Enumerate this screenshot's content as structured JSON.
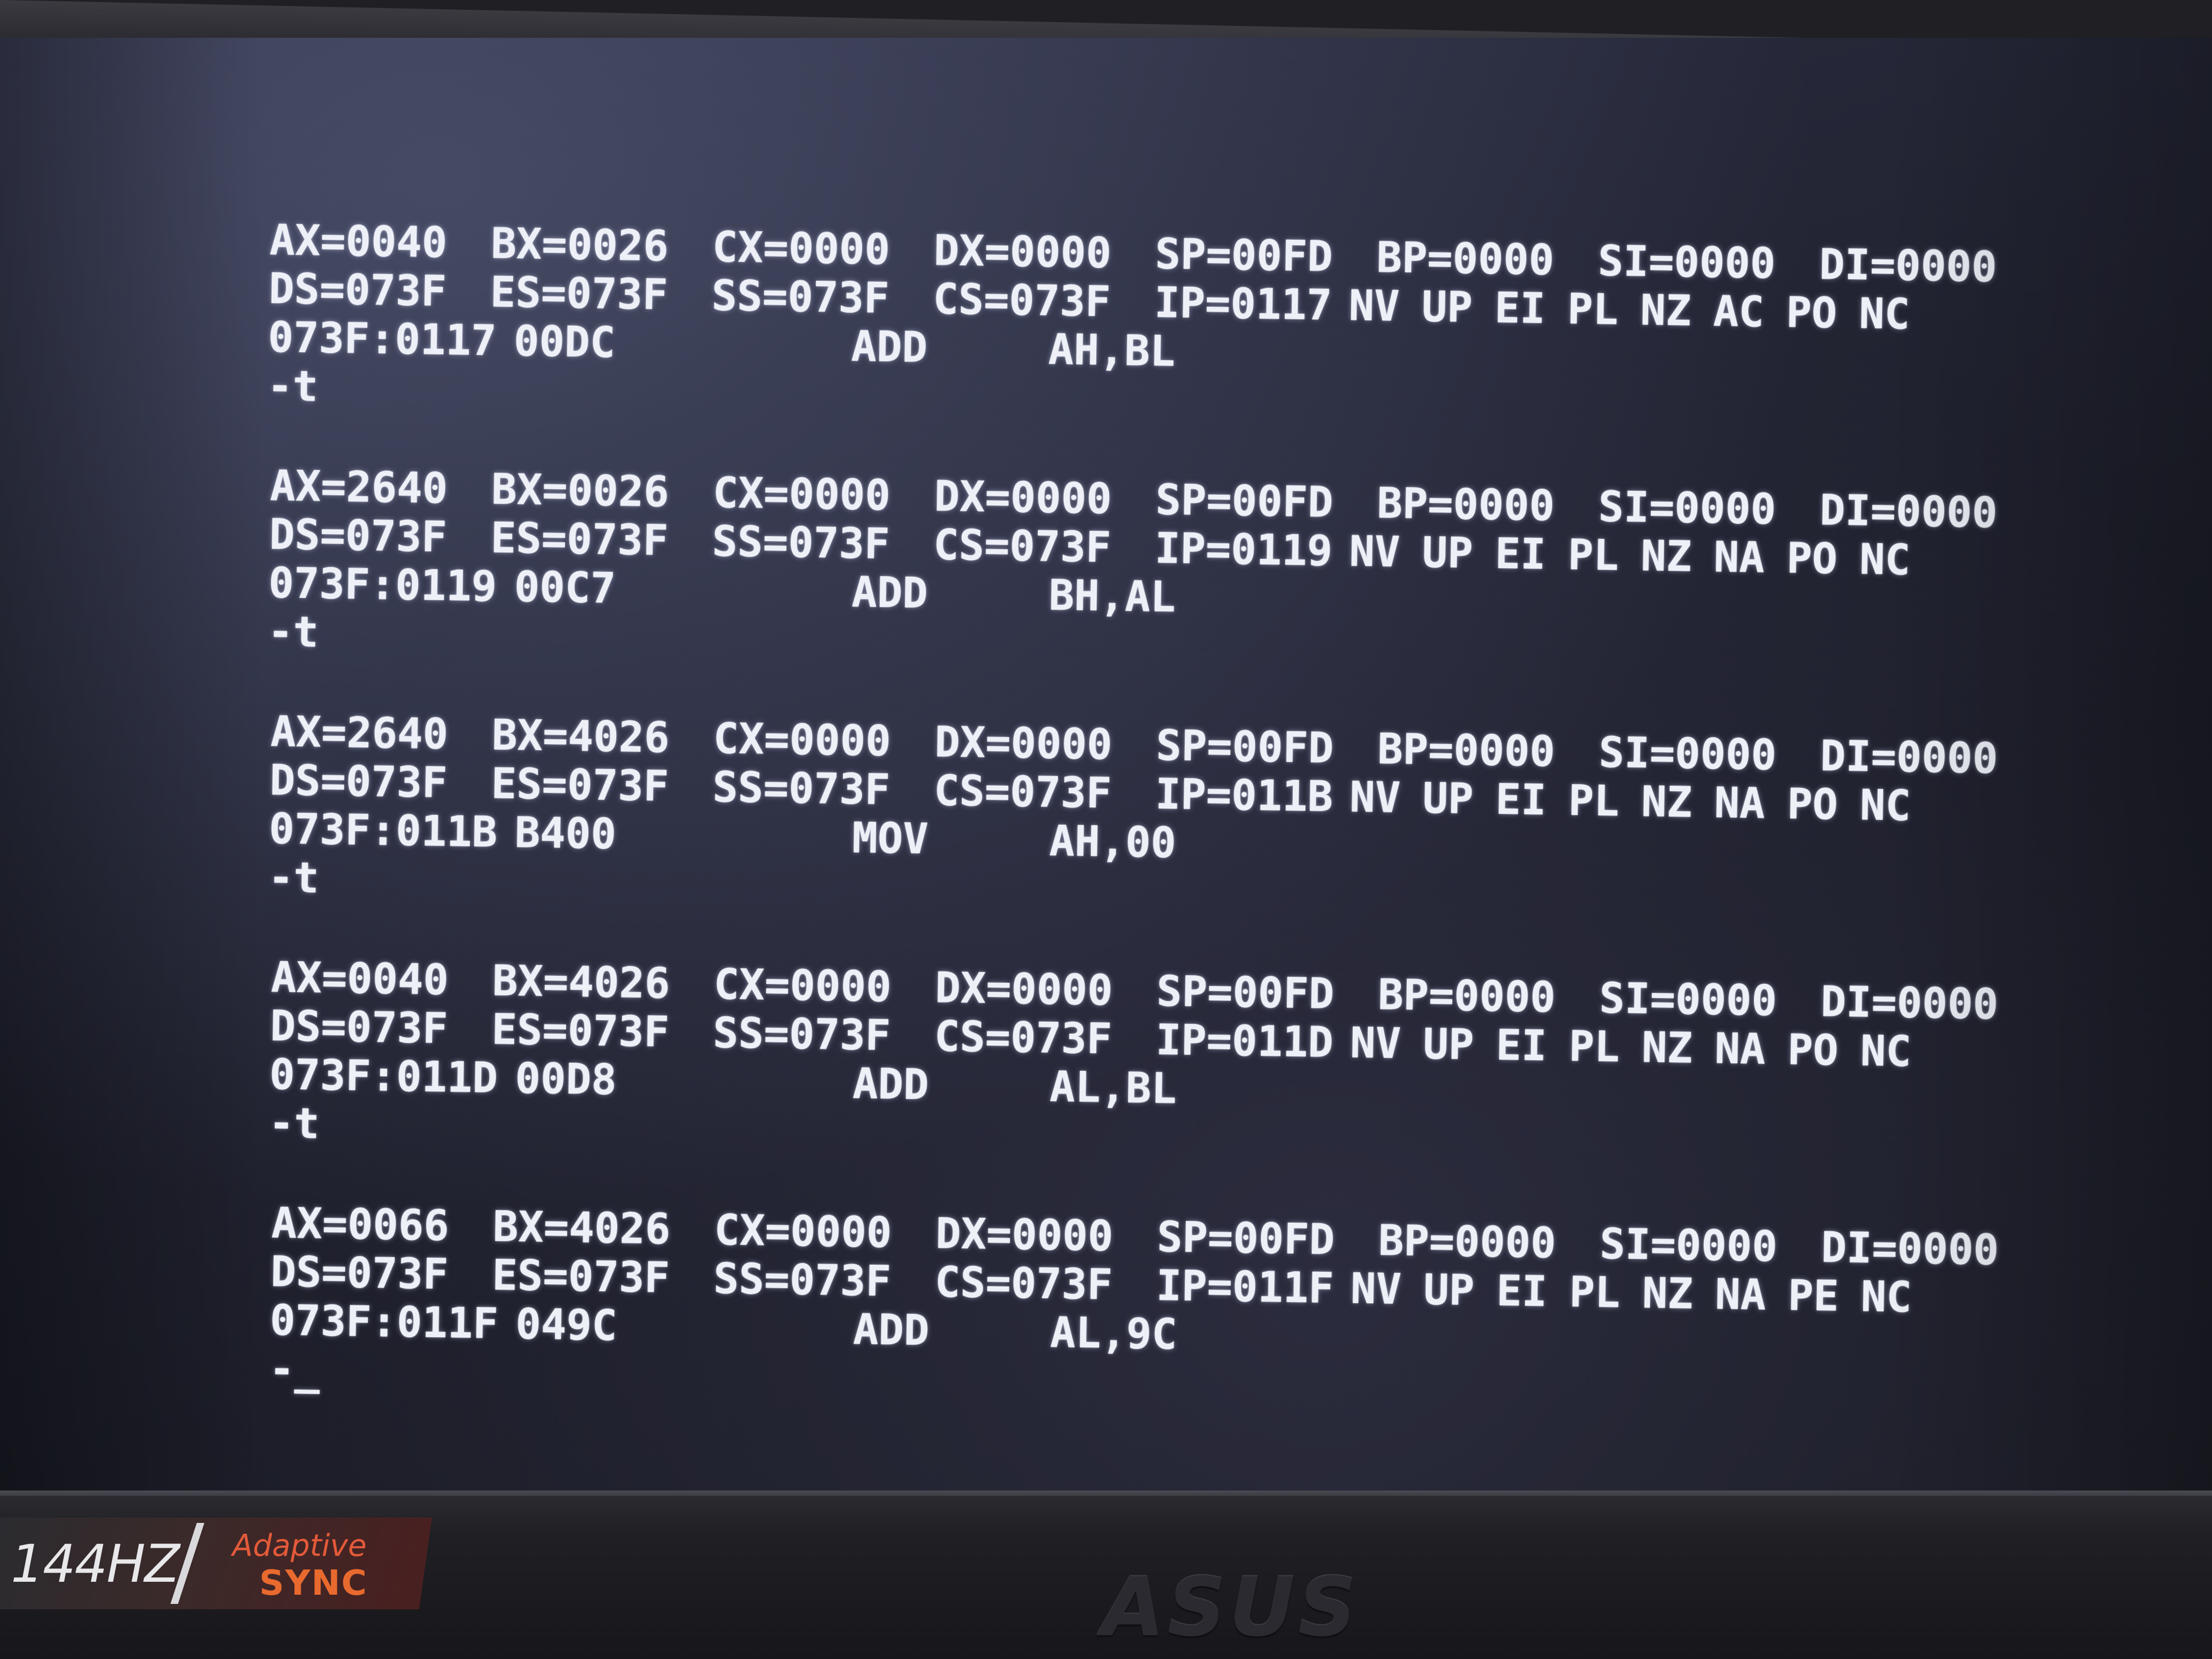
{
  "terminal": {
    "blocks": [
      {
        "regs": [
          "AX=0040",
          "BX=0026",
          "CX=0000",
          "DX=0000",
          "SP=00FD",
          "BP=0000",
          "SI=0000",
          "DI=0000"
        ],
        "segs": [
          "DS=073F",
          "ES=073F",
          "SS=073F",
          "CS=073F",
          "IP=0117"
        ],
        "flags": [
          "NV",
          "UP",
          "EI",
          "PL",
          "NZ",
          "AC",
          "PO",
          "NC"
        ],
        "address": "073F:0117",
        "opcode": "00DC",
        "mnemonic": "ADD",
        "operands": "AH,BL",
        "prompt": "-t"
      },
      {
        "regs": [
          "AX=2640",
          "BX=0026",
          "CX=0000",
          "DX=0000",
          "SP=00FD",
          "BP=0000",
          "SI=0000",
          "DI=0000"
        ],
        "segs": [
          "DS=073F",
          "ES=073F",
          "SS=073F",
          "CS=073F",
          "IP=0119"
        ],
        "flags": [
          "NV",
          "UP",
          "EI",
          "PL",
          "NZ",
          "NA",
          "PO",
          "NC"
        ],
        "address": "073F:0119",
        "opcode": "00C7",
        "mnemonic": "ADD",
        "operands": "BH,AL",
        "prompt": "-t"
      },
      {
        "regs": [
          "AX=2640",
          "BX=4026",
          "CX=0000",
          "DX=0000",
          "SP=00FD",
          "BP=0000",
          "SI=0000",
          "DI=0000"
        ],
        "segs": [
          "DS=073F",
          "ES=073F",
          "SS=073F",
          "CS=073F",
          "IP=011B"
        ],
        "flags": [
          "NV",
          "UP",
          "EI",
          "PL",
          "NZ",
          "NA",
          "PO",
          "NC"
        ],
        "address": "073F:011B",
        "opcode": "B400",
        "mnemonic": "MOV",
        "operands": "AH,00",
        "prompt": "-t"
      },
      {
        "regs": [
          "AX=0040",
          "BX=4026",
          "CX=0000",
          "DX=0000",
          "SP=00FD",
          "BP=0000",
          "SI=0000",
          "DI=0000"
        ],
        "segs": [
          "DS=073F",
          "ES=073F",
          "SS=073F",
          "CS=073F",
          "IP=011D"
        ],
        "flags": [
          "NV",
          "UP",
          "EI",
          "PL",
          "NZ",
          "NA",
          "PO",
          "NC"
        ],
        "address": "073F:011D",
        "opcode": "00D8",
        "mnemonic": "ADD",
        "operands": "AL,BL",
        "prompt": "-t"
      },
      {
        "regs": [
          "AX=0066",
          "BX=4026",
          "CX=0000",
          "DX=0000",
          "SP=00FD",
          "BP=0000",
          "SI=0000",
          "DI=0000"
        ],
        "segs": [
          "DS=073F",
          "ES=073F",
          "SS=073F",
          "CS=073F",
          "IP=011F"
        ],
        "flags": [
          "NV",
          "UP",
          "EI",
          "PL",
          "NZ",
          "NA",
          "PE",
          "NC"
        ],
        "address": "073F:011F",
        "opcode": "049C",
        "mnemonic": "ADD",
        "operands": "AL,9C",
        "prompt": "-_"
      }
    ]
  },
  "bezel": {
    "badge_hz": "144HZ",
    "badge_adaptive": "Adaptive",
    "badge_sync": "SYNC",
    "logo": "ASUS"
  },
  "colors": {
    "terminal_text": "#eef0f8",
    "screen_bg": "#242636",
    "badge_accent": "#e86a2e"
  }
}
